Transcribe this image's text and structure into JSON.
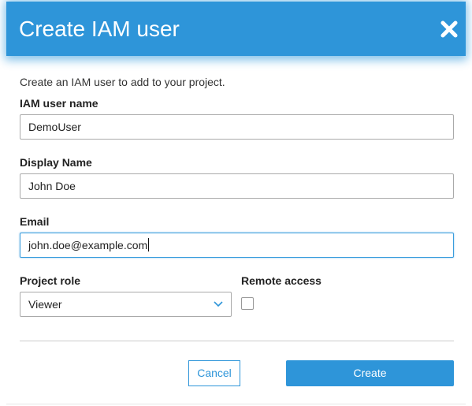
{
  "dialog": {
    "title": "Create IAM user",
    "close_icon": "close-icon",
    "intro": "Create an IAM user to add to your project."
  },
  "fields": {
    "username": {
      "label": "IAM user name",
      "value": "DemoUser"
    },
    "display_name": {
      "label": "Display Name",
      "value": "John Doe"
    },
    "email": {
      "label": "Email",
      "value": "john.doe@example.com"
    },
    "project_role": {
      "label": "Project role",
      "value": "Viewer",
      "icon": "chevron-down-icon"
    },
    "remote_access": {
      "label": "Remote access",
      "checked": false
    }
  },
  "actions": {
    "cancel_label": "Cancel",
    "create_label": "Create"
  },
  "colors": {
    "accent": "#2e95d9",
    "header": "#2e95d9",
    "text": "#222222",
    "border": "#aaaaaa"
  }
}
